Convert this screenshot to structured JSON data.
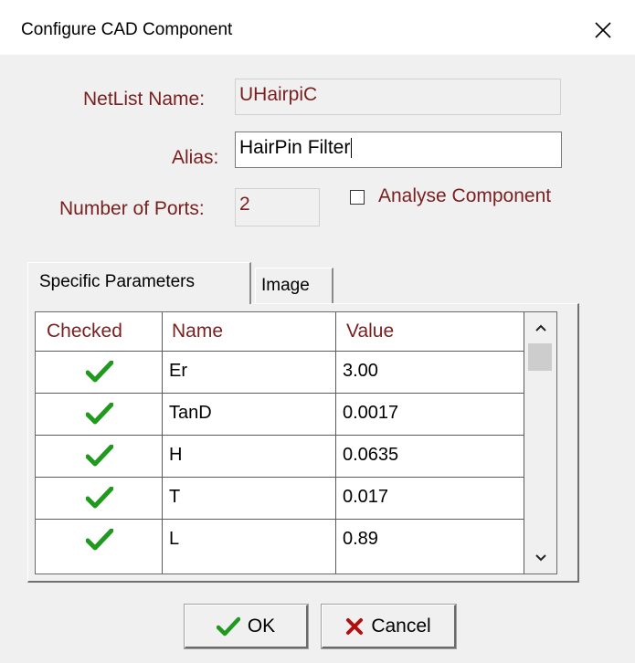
{
  "window": {
    "title": "Configure CAD Component"
  },
  "form": {
    "netlist_label": "NetList Name:",
    "netlist_value": "UHairpiC",
    "alias_label": "Alias:",
    "alias_value": "HairPin Filter",
    "ports_label": "Number of Ports:",
    "ports_value": "2",
    "analyse_label": "Analyse Component",
    "analyse_checked": false
  },
  "tabs": [
    {
      "label": "Specific Parameters",
      "active": true
    },
    {
      "label": "Image",
      "active": false
    }
  ],
  "grid": {
    "headers": [
      "Checked",
      "Name",
      "Value"
    ],
    "rows": [
      {
        "checked": true,
        "name": "Er",
        "value": "3.00"
      },
      {
        "checked": true,
        "name": "TanD",
        "value": "0.0017"
      },
      {
        "checked": true,
        "name": "H",
        "value": "0.0635"
      },
      {
        "checked": true,
        "name": "T",
        "value": "0.017"
      },
      {
        "checked": true,
        "name": "L",
        "value": "0.89"
      }
    ]
  },
  "buttons": {
    "ok_label": "OK",
    "cancel_label": "Cancel"
  },
  "colors": {
    "label_text": "#7a1f1f",
    "check_green": "#1f9a1f",
    "cancel_red": "#b01010"
  }
}
